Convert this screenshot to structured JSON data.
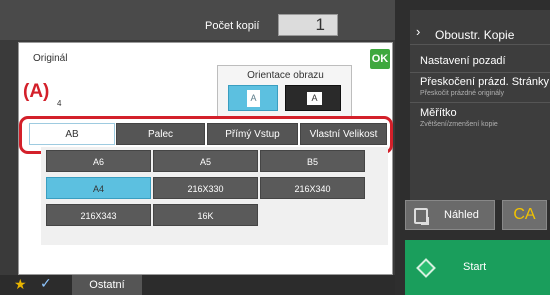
{
  "header": {
    "copies_label": "Počet kopií",
    "copies_value": "1"
  },
  "right_panel": {
    "items": [
      {
        "label": "Oboustr. Kopie",
        "sub": ""
      },
      {
        "label": "Nastavení pozadí",
        "sub": ""
      },
      {
        "label": "Přeskočení prázd. Stránky",
        "sub": "Přeskočit prázdné originály"
      },
      {
        "label": "Měřítko",
        "sub": "Zvětšení/zmenšení kopie"
      }
    ],
    "preview_label": "Náhled",
    "ca_label": "CA",
    "start_label": "Start"
  },
  "bottom_bar": {
    "other_label": "Ostatní"
  },
  "modal": {
    "title": "Originál",
    "ok_label": "OK",
    "orientation_label": "Orientace obrazu",
    "orientation_portrait_glyph": "A",
    "orientation_landscape_glyph": "A",
    "callout": "(A)",
    "callout_sub": "4",
    "tabs": [
      {
        "label": "AB",
        "active": true
      },
      {
        "label": "Palec",
        "active": false
      },
      {
        "label": "Přímý Vstup",
        "active": false
      },
      {
        "label": "Vlastní Velikost",
        "active": false
      }
    ],
    "sizes": [
      {
        "label": "A6",
        "selected": false
      },
      {
        "label": "A5",
        "selected": false
      },
      {
        "label": "B5",
        "selected": false
      },
      {
        "label": "A4",
        "selected": true
      },
      {
        "label": "216X330",
        "selected": false
      },
      {
        "label": "216X340",
        "selected": false
      },
      {
        "label": "216X343",
        "selected": false
      },
      {
        "label": "16K",
        "selected": false
      }
    ]
  },
  "colors": {
    "accent_selected": "#5cc0e0",
    "callout_red": "#d3202a",
    "ok_green": "#3fa83f",
    "start_green": "#1a9e5c",
    "ca_yellow": "#f2c200"
  }
}
